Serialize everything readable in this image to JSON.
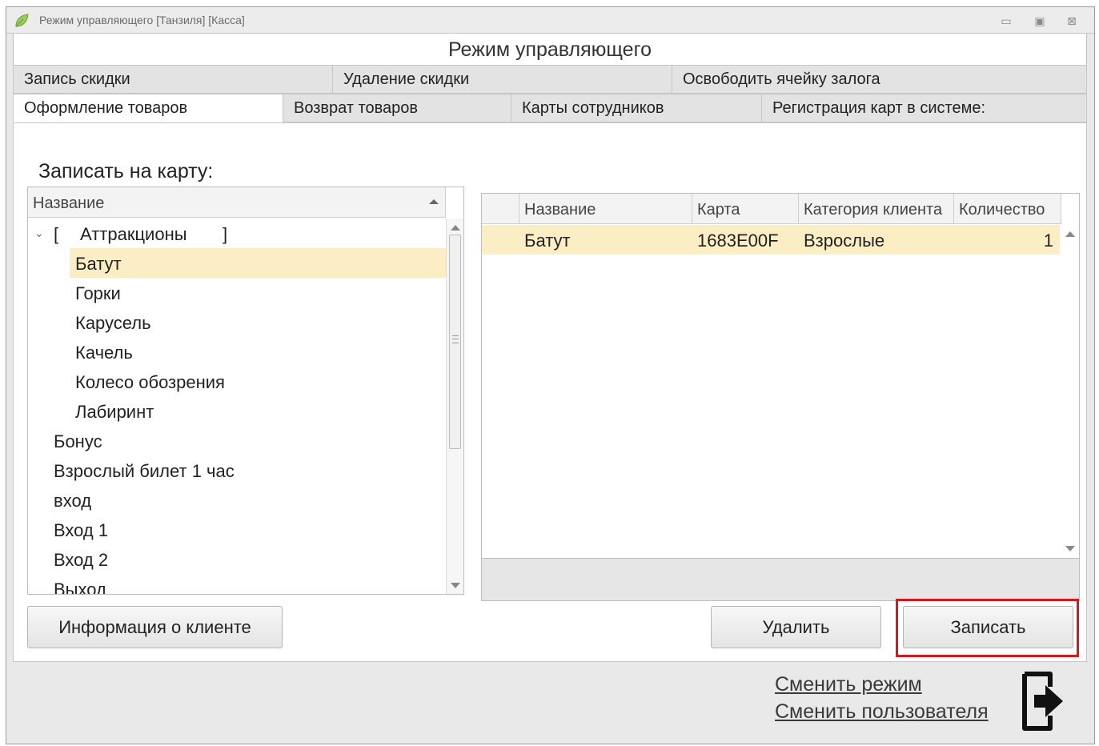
{
  "window": {
    "title": "Режим управляющего [Танзиля] [Касса]",
    "controls": {
      "minimize": "▭",
      "maximize": "▣",
      "close": "⊠"
    },
    "icon": "leaf-app-icon"
  },
  "header": {
    "title": "Режим управляющего"
  },
  "tabs_row1": [
    {
      "label": "Запись скидки"
    },
    {
      "label": "Удаление скидки"
    },
    {
      "label": "Освободить ячейку залога"
    }
  ],
  "tabs_row2": [
    {
      "label": "Оформление товаров",
      "active": true
    },
    {
      "label": "Возврат товаров"
    },
    {
      "label": "Карты сотрудников"
    },
    {
      "label": "Регистрация карт в системе:"
    }
  ],
  "section_label": "Записать на карту:",
  "tree": {
    "column_header": "Название",
    "group": {
      "open_bracket": "[",
      "label": "Аттракционы",
      "close_bracket": "]",
      "expanded": true
    },
    "children": [
      "Батут",
      "Горки",
      "Карусель",
      "Качель",
      "Колесо обозрения",
      "Лабиринт"
    ],
    "selected_child": "Батут",
    "items": [
      "Бонус",
      "Взрослый билет 1 час",
      "вход",
      "Вход 1",
      "Вход 2",
      "Выход"
    ]
  },
  "grid": {
    "columns": [
      "",
      "Название",
      "Карта",
      "Категория клиента",
      "Количество"
    ],
    "rows": [
      {
        "name": "Батут",
        "card": "1683E00F",
        "category": "Взрослые",
        "quantity": "1"
      }
    ]
  },
  "buttons": {
    "client_info": "Информация о клиенте",
    "delete": "Удалить",
    "write": "Записать"
  },
  "links": {
    "change_mode": "Сменить режим",
    "change_user": "Сменить пользователя"
  },
  "colors": {
    "selection": "#fbeec5",
    "highlight_border": "#d9161c"
  }
}
